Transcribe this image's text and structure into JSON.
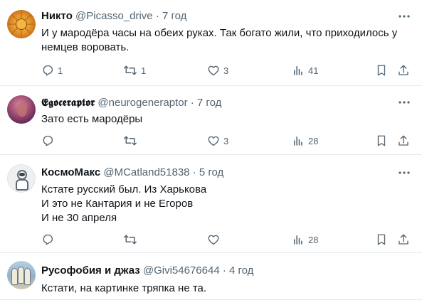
{
  "colors": {
    "text": "#0f1419",
    "secondary": "#536471",
    "divider": "#e6e9ec"
  },
  "tweets": [
    {
      "name": "Никто",
      "handle": "@Picasso_drive",
      "separator": "·",
      "time": "7 год",
      "text_lines": [
        "И у мародёра часы на обеих руках. Так богато жили, что приходилось у",
        "немцев воровать."
      ],
      "replies": "1",
      "retweets": "1",
      "likes": "3",
      "views": "41",
      "avatar_icon": "sun-face-avatar"
    },
    {
      "name": "𝕰𝖌𝖔𝖈𝖊𝖗𝖆𝖕𝖙𝖔𝖗",
      "handle": "@neurogeneraptor",
      "separator": "·",
      "time": "7 год",
      "text_lines": [
        "Зато есть мародёры"
      ],
      "replies": "",
      "retweets": "",
      "likes": "3",
      "views": "28",
      "avatar_icon": "abstract-purple-avatar"
    },
    {
      "name": "КосмоМакс",
      "handle": "@MCatland51838",
      "separator": "·",
      "time": "5 год",
      "text_lines": [
        "Кстате русский был. Из Харькова",
        "И это не Кантария и не Егоров",
        "И не 30 апреля"
      ],
      "replies": "",
      "retweets": "",
      "likes": "",
      "views": "28",
      "avatar_icon": "astronaut-avatar"
    },
    {
      "name": "Русофобия и джаз",
      "handle": "@Givi54676644",
      "separator": "·",
      "time": "4 год",
      "text_lines": [
        "Кстати, на картинке тряпка не та."
      ],
      "avatar_icon": "group-photo-avatar"
    }
  ]
}
